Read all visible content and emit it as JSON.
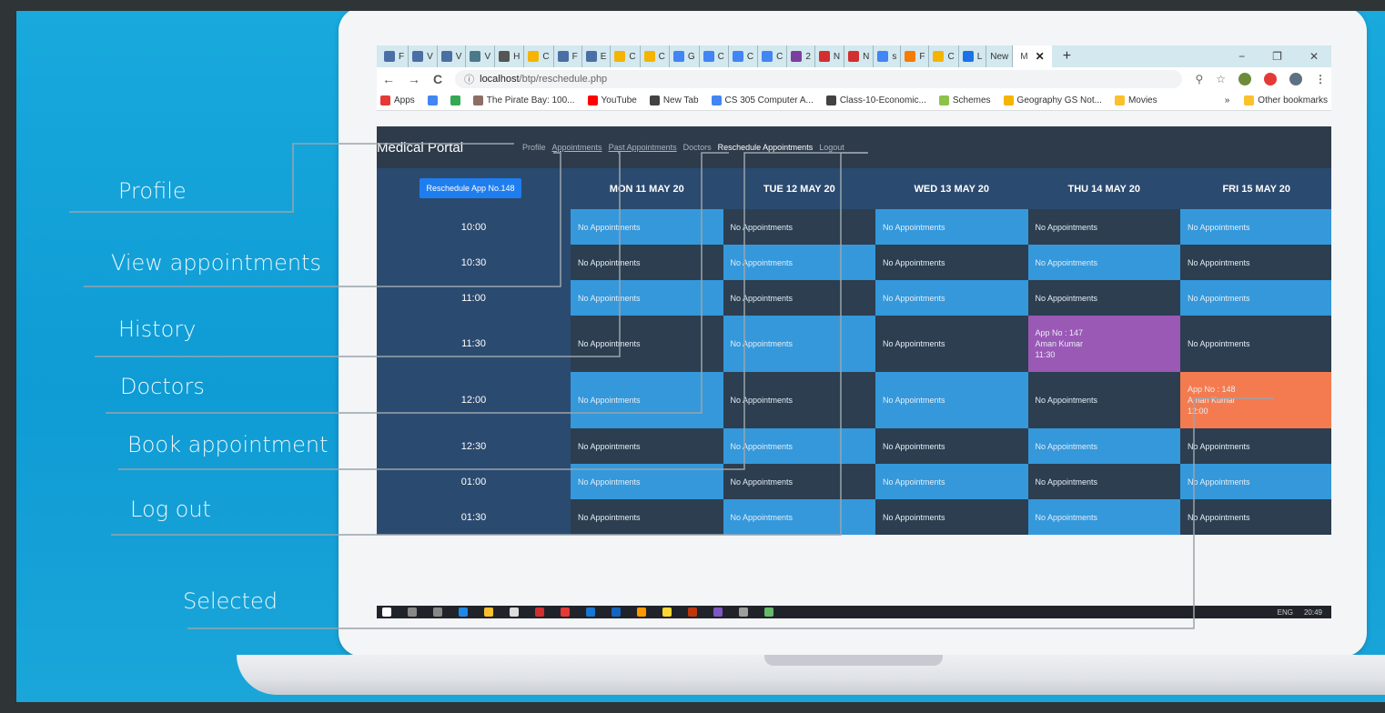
{
  "annotations": [
    {
      "label": "Profile"
    },
    {
      "label": "View appointments"
    },
    {
      "label": "History"
    },
    {
      "label": "Doctors"
    },
    {
      "label": "Book appointment"
    },
    {
      "label": "Log out"
    },
    {
      "label": "Selected"
    }
  ],
  "browser": {
    "tabs": [
      {
        "letter": "F",
        "color": "#4a6fa5"
      },
      {
        "letter": "V",
        "color": "#4a6fa5"
      },
      {
        "letter": "V",
        "color": "#4a6fa5"
      },
      {
        "letter": "V",
        "color": "#4a7a8a"
      },
      {
        "letter": "H",
        "color": "#555555"
      },
      {
        "letter": "C",
        "color": "#f4b400"
      },
      {
        "letter": "F",
        "color": "#4a6fa5"
      },
      {
        "letter": "E",
        "color": "#4a6fa5"
      },
      {
        "letter": "C",
        "color": "#f4b400"
      },
      {
        "letter": "C",
        "color": "#f4b400"
      },
      {
        "letter": "G",
        "color": "#4285f4"
      },
      {
        "letter": "C",
        "color": "#4285f4"
      },
      {
        "letter": "C",
        "color": "#4285f4"
      },
      {
        "letter": "C",
        "color": "#4285f4"
      },
      {
        "letter": "2",
        "color": "#7b3fa0"
      },
      {
        "letter": "N",
        "color": "#d32f2f"
      },
      {
        "letter": "N",
        "color": "#d32f2f"
      },
      {
        "letter": "s",
        "color": "#4285f4"
      },
      {
        "letter": "F",
        "color": "#f57c00"
      },
      {
        "letter": "C",
        "color": "#f4b400"
      },
      {
        "letter": "L",
        "color": "#1a73e8"
      },
      {
        "letter": "New",
        "color": "#ffffff"
      }
    ],
    "active_tab": {
      "label": "M",
      "close": "✕"
    },
    "new_tab": "+",
    "window_controls": [
      "−",
      "❐",
      "✕"
    ],
    "nav": {
      "back": "←",
      "forward": "→",
      "reload": "C"
    },
    "url_host": "localhost",
    "url_path": "/btp/reschedule.php",
    "bookmarks": [
      {
        "label": "Apps",
        "color": "#e53935"
      },
      {
        "label": "",
        "color": "#4285f4"
      },
      {
        "label": "",
        "color": "#34a853"
      },
      {
        "label": "The Pirate Bay: 100...",
        "color": "#8d6e63"
      },
      {
        "label": "YouTube",
        "color": "#ff0000"
      },
      {
        "label": "New Tab",
        "color": "#424242"
      },
      {
        "label": "CS 305 Computer A...",
        "color": "#4285f4"
      },
      {
        "label": "Class-10-Economic...",
        "color": "#424242"
      },
      {
        "label": "Schemes",
        "color": "#8bc34a"
      },
      {
        "label": "Geography GS Not...",
        "color": "#f4b400"
      },
      {
        "label": "Movies",
        "color": "#fbc02d"
      }
    ],
    "more_bookmarks": "»",
    "other_bookmarks": "Other bookmarks"
  },
  "app": {
    "brand": "Medical Portal",
    "nav": [
      {
        "label": "Profile",
        "style": "plain"
      },
      {
        "label": "Appointments",
        "style": "underline"
      },
      {
        "label": "Past Appointments",
        "style": "underline"
      },
      {
        "label": "Doctors",
        "style": "plain"
      },
      {
        "label": "Reschedule Appointments",
        "style": "active"
      },
      {
        "label": "Logout",
        "style": "plain"
      }
    ],
    "reschedule_button": "Reschedule App No.148",
    "days": [
      "MON 11 MAY 20",
      "TUE 12 MAY 20",
      "WED 13 MAY 20",
      "THU 14 MAY 20",
      "FRI 15 MAY 20"
    ],
    "times": [
      "10:00",
      "10:30",
      "11:00",
      "11:30",
      "12:00",
      "12:30",
      "01:00",
      "01:30"
    ],
    "empty_text": "No Appointments",
    "booked": [
      {
        "day": 3,
        "slot": 3,
        "lines": [
          "App No : 147",
          "Aman Kumar",
          "11:30"
        ],
        "color": "#9b59b6"
      },
      {
        "day": 4,
        "slot": 4,
        "lines": [
          "App No : 148",
          "Aman Kumar",
          "12:00"
        ],
        "color": "#f47b50"
      }
    ],
    "colors": {
      "light": "#3498db",
      "dark": "#2c3e50",
      "header": "#2b4a6f",
      "time_col": "#2b4a6f"
    }
  },
  "taskbar": {
    "lang": "ENG",
    "time": "20:49"
  }
}
